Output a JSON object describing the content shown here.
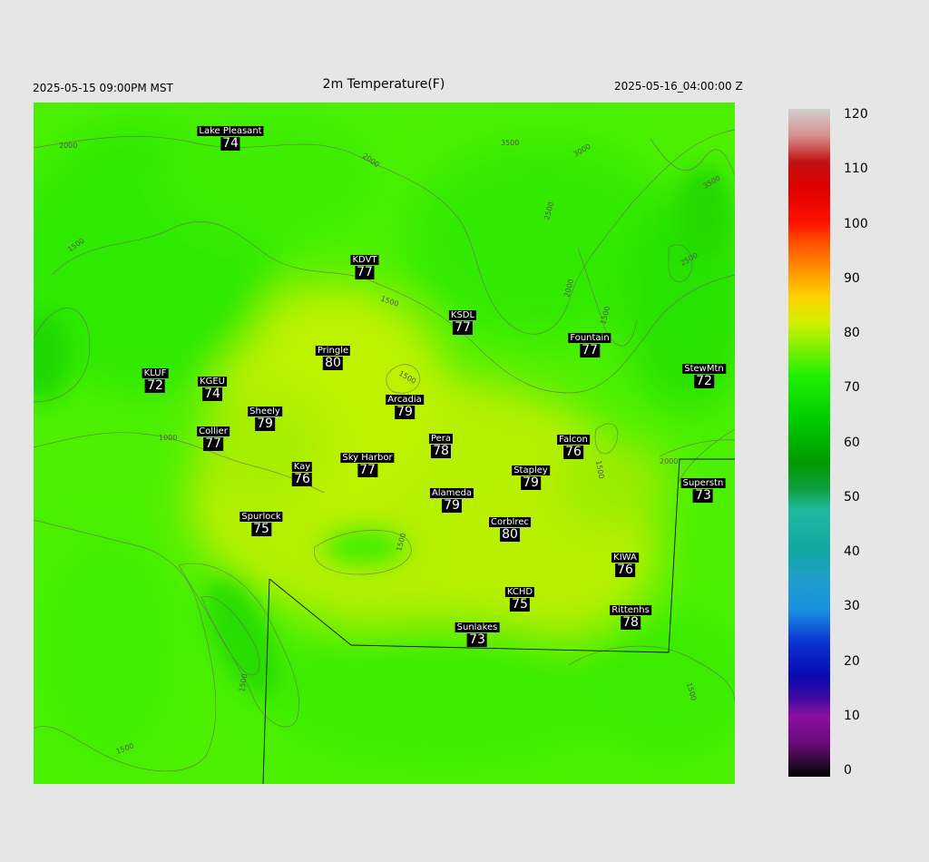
{
  "header": {
    "left": "2025-05-15 09:00PM MST",
    "title": "2m Temperature(F)",
    "right": "2025-05-16_04:00:00 Z"
  },
  "colorbar": {
    "ticks": [
      "120",
      "110",
      "100",
      "90",
      "80",
      "70",
      "60",
      "50",
      "40",
      "30",
      "20",
      "10",
      "0"
    ],
    "min": 0,
    "max": 120
  },
  "contour_labels": [
    "2000",
    "1500",
    "1000",
    "2000",
    "3500",
    "3000",
    "2500",
    "2000",
    "1500",
    "1500",
    "2500",
    "3500",
    "2000",
    "1500",
    "1500",
    "1500",
    "1500",
    "1500",
    "1500"
  ],
  "stations": [
    {
      "name": "Lake Pleasant",
      "value": "74"
    },
    {
      "name": "KDVT",
      "value": "77"
    },
    {
      "name": "KSDL",
      "value": "77"
    },
    {
      "name": "Fountain",
      "value": "77"
    },
    {
      "name": "Pringle",
      "value": "80"
    },
    {
      "name": "StewMtn",
      "value": "72"
    },
    {
      "name": "KLUF",
      "value": "72"
    },
    {
      "name": "KGEU",
      "value": "74"
    },
    {
      "name": "Arcadia",
      "value": "79"
    },
    {
      "name": "Sheely",
      "value": "79"
    },
    {
      "name": "Collier",
      "value": "77"
    },
    {
      "name": "Pera",
      "value": "78"
    },
    {
      "name": "Falcon",
      "value": "76"
    },
    {
      "name": "Kay",
      "value": "76"
    },
    {
      "name": "Sky Harbor",
      "value": "77"
    },
    {
      "name": "Stapley",
      "value": "79"
    },
    {
      "name": "Superstn",
      "value": "73"
    },
    {
      "name": "Alameda",
      "value": "79"
    },
    {
      "name": "Spurlock",
      "value": "75"
    },
    {
      "name": "Corblrec",
      "value": "80"
    },
    {
      "name": "KIWA",
      "value": "76"
    },
    {
      "name": "KCHD",
      "value": "75"
    },
    {
      "name": "Rittenhs",
      "value": "78"
    },
    {
      "name": "Sunlakes",
      "value": "73"
    }
  ]
}
